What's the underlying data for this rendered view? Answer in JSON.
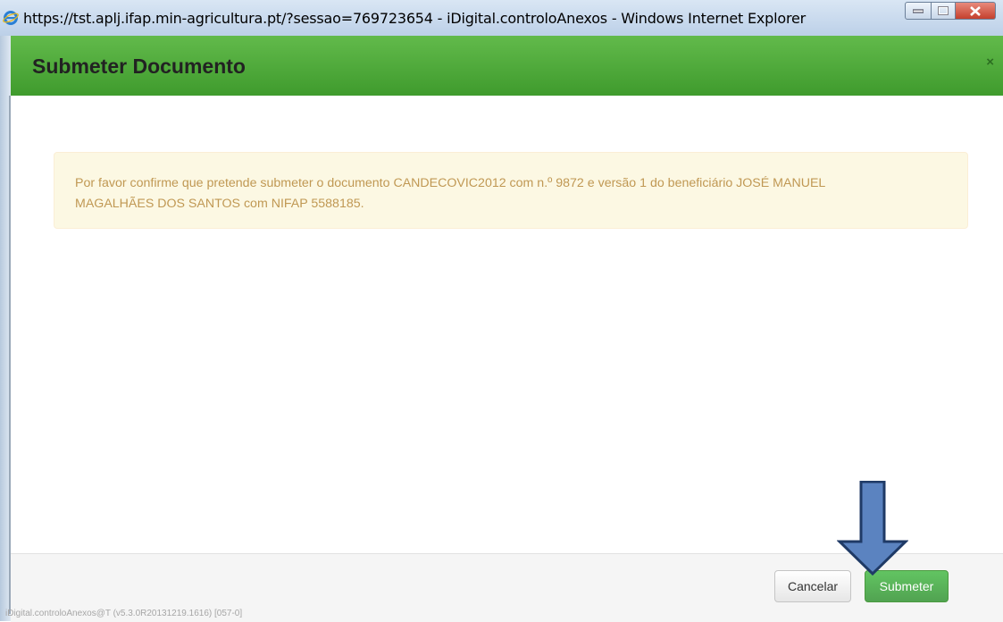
{
  "window": {
    "title": "https://tst.aplj.ifap.min-agricultura.pt/?sessao=769723654 - iDigital.controloAnexos - Windows Internet Explorer",
    "icon": "ie-icon"
  },
  "modal": {
    "title": "Submeter Documento",
    "close_symbol": "×",
    "message": "Por favor confirme que pretende submeter o documento CANDECOVIC2012 com n.º 9872 e versão 1 do beneficiário JOSÉ MANUEL MAGALHÃES DOS SANTOS com NIFAP 5588185."
  },
  "footer": {
    "cancel_label": "Cancelar",
    "submit_label": "Submeter"
  },
  "version_text": "iDigital.controloAnexos@T (v5.3.0R20131219.1616) [057-0]",
  "colors": {
    "header_green": "#4caf3a",
    "alert_bg": "#fcf8e3",
    "alert_text": "#c09853",
    "submit_green": "#5bb75b",
    "arrow_fill": "#5b83c0",
    "arrow_stroke": "#1f3a66"
  }
}
